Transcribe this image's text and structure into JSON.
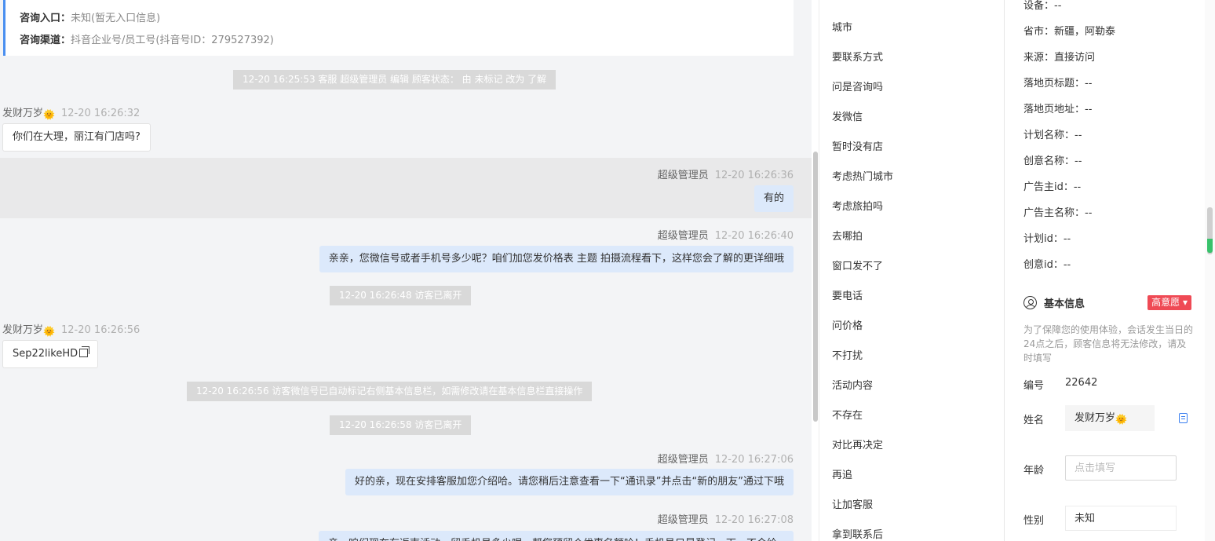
{
  "consult": {
    "entry_label": "咨询入口：",
    "entry_value": "未知(暂无入口信息)",
    "channel_label": "咨询渠道：",
    "channel_value": "抖音企业号/员工号(抖音号ID：279527392)"
  },
  "messages": [
    {
      "type": "system",
      "text": "12-20 16:25:53 客服 超级管理员 编辑 顾客状态： 由 未标记 改为 了解"
    },
    {
      "type": "in",
      "sender": "发财万岁",
      "time": "12-20 16:26:32",
      "text": "你们在大理，丽江有门店吗?"
    },
    {
      "type": "out",
      "sender": "超级管理员",
      "time": "12-20 16:26:36",
      "text": "有的"
    },
    {
      "type": "out",
      "sender": "超级管理员",
      "time": "12-20 16:26:40",
      "text": "亲亲，您微信号或者手机号多少呢？咱们加您发价格表 主题 拍摄流程看下，这样您会了解的更详细哦"
    },
    {
      "type": "system",
      "text": "12-20 16:26:48 访客已离开"
    },
    {
      "type": "in",
      "sender": "发财万岁",
      "time": "12-20 16:26:56",
      "text": "Sep22likeHD"
    },
    {
      "type": "system",
      "text": "12-20 16:26:56 访客微信号已自动标记右侧基本信息栏，如需修改请在基本信息栏直接操作"
    },
    {
      "type": "system",
      "text": "12-20 16:26:58 访客已离开"
    },
    {
      "type": "out",
      "sender": "超级管理员",
      "time": "12-20 16:27:06",
      "text": "好的亲，现在安排客服加您介绍哈。请您稍后注意查看一下“通讯录”并点击“新的朋友”通过下哦"
    },
    {
      "type": "out",
      "sender": "超级管理员",
      "time": "12-20 16:27:08",
      "text": "亲，咱们现在有返南活动，留手机号多少呢，帮您预留个优惠名额哈！手机号只是登记一下，不会给"
    }
  ],
  "emoji": {
    "sun": "🌞"
  },
  "quick_replies": [
    "城市",
    "要联系方式",
    "问是咨询吗",
    "发微信",
    "暂时没有店",
    "考虑热门城市",
    "考虑旅拍吗",
    "去哪拍",
    "窗口发不了",
    "要电话",
    "问价格",
    "不打扰",
    "活动内容",
    "不存在",
    "对比再决定",
    "再追",
    "让加客服",
    "拿到联系后"
  ],
  "customer": {
    "attrs": [
      "设备：--",
      "省市：新疆，阿勒泰",
      "来源：直接访问",
      "落地页标题：--",
      "落地页地址：--",
      "计划名称：--",
      "创意名称：--",
      "广告主id：--",
      "广告主名称：--",
      "计划id：--",
      "创意id：--"
    ],
    "basic_title": "基本信息",
    "intent_badge": "高意愿 ▾",
    "notice": "为了保障您的使用体验，会话发生当日的24点之后，顾客信息将无法修改，请及时填写",
    "number_label": "编号",
    "number_value": "22642",
    "name_label": "姓名",
    "name_value": "发财万岁",
    "age_label": "年龄",
    "age_placeholder": "点击填写",
    "gender_label": "性别",
    "gender_value": "未知"
  },
  "colors": {
    "accent": "#4a8ff0",
    "out_bubble": "#dce9fb",
    "badge": "#ef4a55",
    "system": "#d9d9d9"
  }
}
